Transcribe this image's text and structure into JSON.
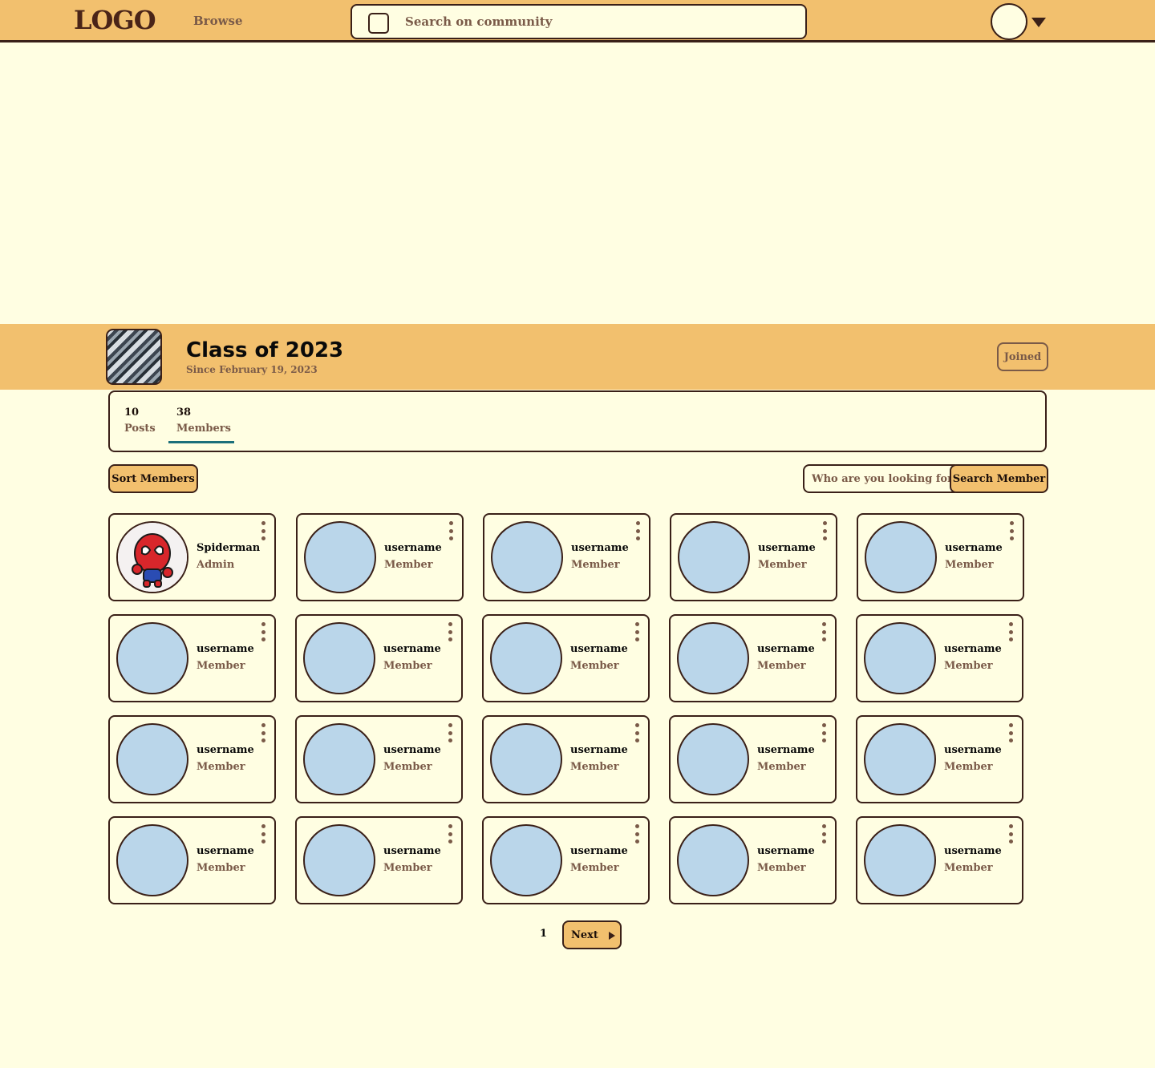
{
  "nav": {
    "logo": "LOGO",
    "browse": "Browse",
    "search_placeholder": "Search on community"
  },
  "group": {
    "title": "Class of 2023",
    "since": "Since February 19, 2023",
    "joined_label": "Joined"
  },
  "stats": {
    "posts_count": "10",
    "posts_label": "Posts",
    "members_count": "38",
    "members_label": "Members"
  },
  "toolbar": {
    "sort_label": "Sort Members",
    "search_placeholder": "Who are you looking for?",
    "search_button": "Search Member"
  },
  "members": [
    {
      "name": "Spiderman",
      "role": "Admin"
    },
    {
      "name": "username",
      "role": "Member"
    },
    {
      "name": "username",
      "role": "Member"
    },
    {
      "name": "username",
      "role": "Member"
    },
    {
      "name": "username",
      "role": "Member"
    },
    {
      "name": "username",
      "role": "Member"
    },
    {
      "name": "username",
      "role": "Member"
    },
    {
      "name": "username",
      "role": "Member"
    },
    {
      "name": "username",
      "role": "Member"
    },
    {
      "name": "username",
      "role": "Member"
    },
    {
      "name": "username",
      "role": "Member"
    },
    {
      "name": "username",
      "role": "Member"
    },
    {
      "name": "username",
      "role": "Member"
    },
    {
      "name": "username",
      "role": "Member"
    },
    {
      "name": "username",
      "role": "Member"
    },
    {
      "name": "username",
      "role": "Member"
    },
    {
      "name": "username",
      "role": "Member"
    },
    {
      "name": "username",
      "role": "Member"
    },
    {
      "name": "username",
      "role": "Member"
    },
    {
      "name": "username",
      "role": "Member"
    }
  ],
  "pagination": {
    "current_page": "1",
    "next_label": "Next"
  },
  "colors": {
    "background": "#fffee2",
    "accent": "#f2c06e",
    "border": "#3a2018",
    "muted_text": "#7a5a48",
    "avatar_placeholder": "#bad6ea",
    "tab_indicator": "#1b6f7a"
  }
}
